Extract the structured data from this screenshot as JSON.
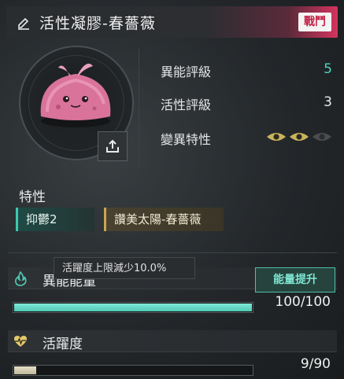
{
  "header": {
    "title": "活性凝膠-春薔薇",
    "tag": "戰鬥"
  },
  "stats": [
    {
      "label": "異能評級",
      "value": "5",
      "color": "#48d6c0"
    },
    {
      "label": "活性評級",
      "value": "3",
      "color": "#e8e8e8"
    },
    {
      "label": "變異特性",
      "eyes_active": 2,
      "eyes_total": 3
    }
  ],
  "traits": {
    "title": "特性",
    "items": [
      {
        "label": "抑鬱2",
        "accent": "#3ec8b0"
      },
      {
        "label": "讚美太陽-春薔薇",
        "accent": "#c9a651"
      }
    ]
  },
  "tooltip": {
    "text": "活躍度上限減少10.0%"
  },
  "energy": {
    "title": "異能能量",
    "button": "能量提升",
    "current": 100,
    "max": 100,
    "display": "100/100"
  },
  "activity": {
    "title": "活躍度",
    "current": 9,
    "max": 90,
    "display": "9/90"
  },
  "colors": {
    "accent_pink": "#d4345e",
    "accent_teal": "#4fc9b4"
  }
}
